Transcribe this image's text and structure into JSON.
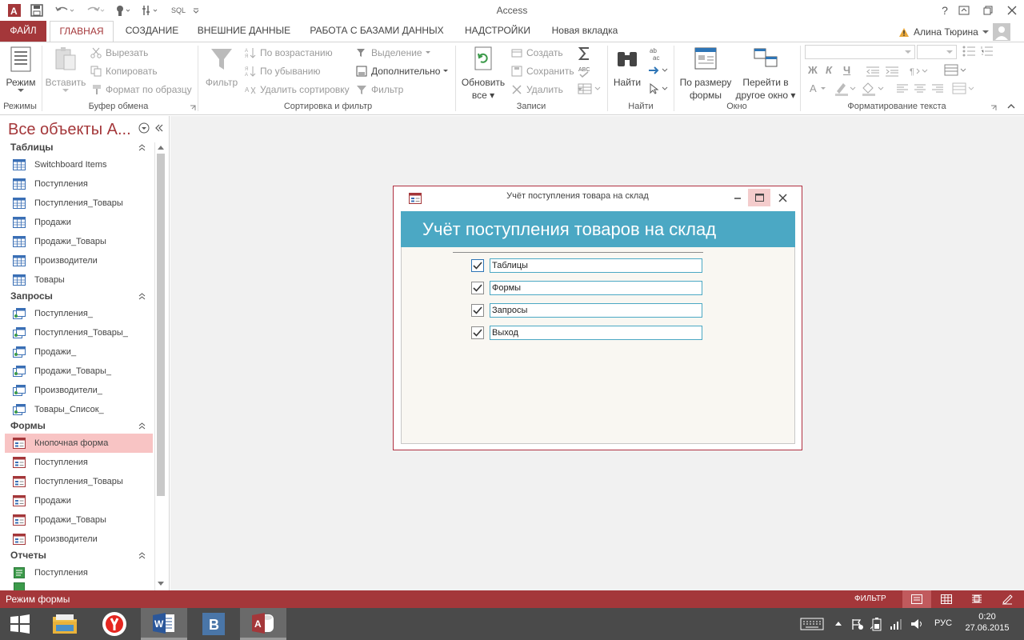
{
  "window": {
    "title": "Access"
  },
  "qat": {
    "sql": "SQL"
  },
  "tabs": [
    {
      "label": "ФАЙЛ"
    },
    {
      "label": "ГЛАВНАЯ"
    },
    {
      "label": "СОЗДАНИЕ"
    },
    {
      "label": "ВНЕШНИЕ ДАННЫЕ"
    },
    {
      "label": "РАБОТА С БАЗАМИ ДАННЫХ"
    },
    {
      "label": "НАДСТРОЙКИ"
    },
    {
      "label": "Новая вкладка"
    }
  ],
  "user": {
    "name": "Алина Тюрина"
  },
  "ribbon": {
    "views": {
      "mode": "Режим",
      "group": "Режимы"
    },
    "clipboard": {
      "paste": "Вставить",
      "cut": "Вырезать",
      "copy": "Копировать",
      "format": "Формат по образцу",
      "group": "Буфер обмена"
    },
    "sort": {
      "filter": "Фильтр",
      "asc": "По возрастанию",
      "desc": "По убыванию",
      "remove": "Удалить сортировку",
      "selection": "Выделение",
      "advanced": "Дополнительно",
      "toggle": "Фильтр",
      "group": "Сортировка и фильтр"
    },
    "records": {
      "refresh1": "Обновить",
      "refresh2": "все",
      "new": "Создать",
      "save": "Сохранить",
      "delete": "Удалить",
      "group": "Записи"
    },
    "find": {
      "find": "Найти",
      "group": "Найти"
    },
    "window": {
      "size1": "По размеру",
      "size2": "формы",
      "switch1": "Перейти в",
      "switch2": "другое окно",
      "group": "Окно"
    },
    "text": {
      "group": "Форматирование текста",
      "bold": "Ж",
      "italic": "К",
      "underline": "Ч",
      "fontcolor": "А"
    }
  },
  "nav": {
    "title": "Все объекты А...",
    "sections": [
      {
        "name": "Таблицы",
        "items": [
          "Switchboard Items",
          "Поступления",
          "Поступления_Товары",
          "Продажи",
          "Продажи_Товары",
          "Производители",
          "Товары"
        ]
      },
      {
        "name": "Запросы",
        "items": [
          "Поступления_",
          "Поступления_Товары_",
          "Продажи_",
          "Продажи_Товары_",
          "Производители_",
          "Товары_Список_"
        ]
      },
      {
        "name": "Формы",
        "items": [
          "Кнопочная форма",
          "Поступления",
          "Поступления_Товары",
          "Продажи",
          "Продажи_Товары",
          "Производители"
        ]
      },
      {
        "name": "Отчеты",
        "items": [
          "Поступления"
        ]
      }
    ]
  },
  "form": {
    "window_title": "Учёт поступления товара на склад",
    "header": "Учёт поступления товаров на склад",
    "items": [
      "Таблицы",
      "Формы",
      "Запросы",
      "Выход"
    ]
  },
  "status": {
    "left": "Режим формы",
    "filter": "ФИЛЬТР"
  },
  "taskbar": {
    "lang": "РУС",
    "time": "0:20",
    "date": "27.06.2015"
  }
}
